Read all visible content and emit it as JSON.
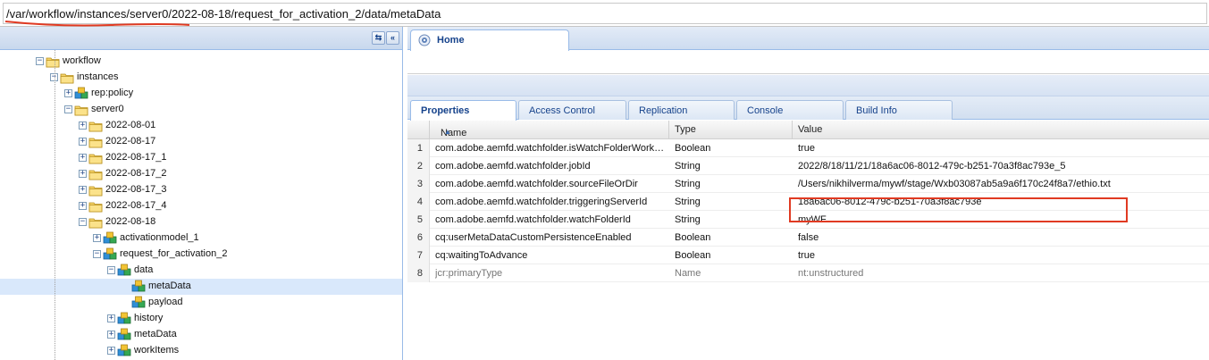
{
  "path_bar": {
    "value": "/var/workflow/instances/server0/2022-08-18/request_for_activation_2/data/metaData"
  },
  "left_toolbar": {
    "refresh_glyph": "⇆",
    "collapse_glyph": "«"
  },
  "tree": [
    {
      "label": "workflow",
      "depth": 0,
      "expanded": true,
      "icon": "folder-icon"
    },
    {
      "label": "instances",
      "depth": 1,
      "expanded": true,
      "icon": "folder-icon"
    },
    {
      "label": "rep:policy",
      "depth": 2,
      "expanded": false,
      "icon": "node-icon"
    },
    {
      "label": "server0",
      "depth": 2,
      "expanded": true,
      "icon": "folder-icon"
    },
    {
      "label": "2022-08-01",
      "depth": 3,
      "expanded": false,
      "icon": "folder-icon"
    },
    {
      "label": "2022-08-17",
      "depth": 3,
      "expanded": false,
      "icon": "folder-icon"
    },
    {
      "label": "2022-08-17_1",
      "depth": 3,
      "expanded": false,
      "icon": "folder-icon"
    },
    {
      "label": "2022-08-17_2",
      "depth": 3,
      "expanded": false,
      "icon": "folder-icon"
    },
    {
      "label": "2022-08-17_3",
      "depth": 3,
      "expanded": false,
      "icon": "folder-icon"
    },
    {
      "label": "2022-08-17_4",
      "depth": 3,
      "expanded": false,
      "icon": "folder-icon"
    },
    {
      "label": "2022-08-18",
      "depth": 3,
      "expanded": true,
      "icon": "folder-icon"
    },
    {
      "label": "activationmodel_1",
      "depth": 4,
      "expanded": false,
      "icon": "node-icon"
    },
    {
      "label": "request_for_activation_2",
      "depth": 4,
      "expanded": true,
      "icon": "node-icon"
    },
    {
      "label": "data",
      "depth": 5,
      "expanded": true,
      "icon": "node-icon"
    },
    {
      "label": "metaData",
      "depth": 6,
      "leaf": true,
      "selected": true,
      "icon": "node-icon"
    },
    {
      "label": "payload",
      "depth": 6,
      "leaf": true,
      "icon": "node-icon"
    },
    {
      "label": "history",
      "depth": 5,
      "expanded": false,
      "icon": "node-icon"
    },
    {
      "label": "metaData",
      "depth": 5,
      "expanded": false,
      "icon": "node-icon"
    },
    {
      "label": "workItems",
      "depth": 5,
      "expanded": false,
      "icon": "node-icon"
    }
  ],
  "home_tab": {
    "label": "Home",
    "icon": "home-icon"
  },
  "property_tabs": [
    "Properties",
    "Access Control",
    "Replication",
    "Console",
    "Build Info"
  ],
  "grid": {
    "columns": [
      "Name",
      "Type",
      "Value"
    ],
    "sort_arrow": "▲",
    "rows": [
      {
        "num": "1",
        "name": "com.adobe.aemfd.watchfolder.isWatchFolderWork…",
        "type": "Boolean",
        "value": "true"
      },
      {
        "num": "2",
        "name": "com.adobe.aemfd.watchfolder.jobId",
        "type": "String",
        "value": "2022/8/18/11/21/18a6ac06-8012-479c-b251-70a3f8ac793e_5"
      },
      {
        "num": "3",
        "name": "com.adobe.aemfd.watchfolder.sourceFileOrDir",
        "type": "String",
        "value": "/Users/nikhilverma/mywf/stage/Wxb03087ab5a9a6f170c24f8a7/ethio.txt"
      },
      {
        "num": "4",
        "name": "com.adobe.aemfd.watchfolder.triggeringServerId",
        "type": "String",
        "value": "18a6ac06-8012-479c-b251-70a3f8ac793e"
      },
      {
        "num": "5",
        "name": "com.adobe.aemfd.watchfolder.watchFolderId",
        "type": "String",
        "value": "myWF"
      },
      {
        "num": "6",
        "name": "cq:userMetaDataCustomPersistenceEnabled",
        "type": "Boolean",
        "value": "false"
      },
      {
        "num": "7",
        "name": "cq:waitingToAdvance",
        "type": "Boolean",
        "value": "true"
      },
      {
        "num": "8",
        "name": "jcr:primaryType",
        "type": "Name",
        "value": "nt:unstructured",
        "dim": true
      }
    ]
  },
  "annotation_colors": {
    "underline": "#e03a22",
    "box": "#e03a22"
  }
}
